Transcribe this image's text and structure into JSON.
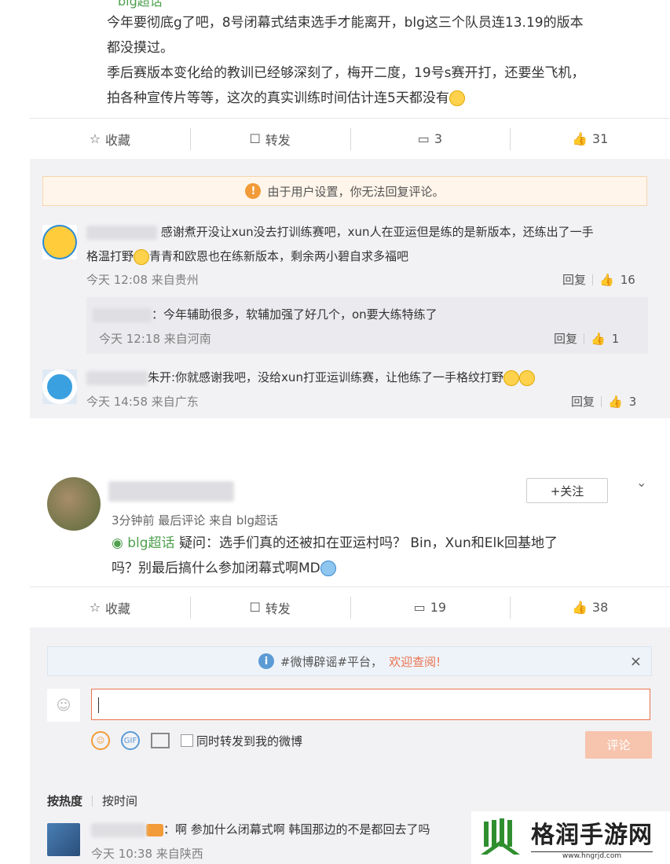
{
  "post1": {
    "topic_label": "blg超话",
    "lines": [
      "今年要彻底g了吧，8号闭幕式结束选手才能离开，blg这三个队员连13.19的版本",
      "都没摸过。",
      "季后赛版本变化给的教训已经够深刻了，梅开二度，19号s赛开打，还要坐飞机，",
      "拍各种宣传片等等，这次的真实训练时间估计连5天都没有"
    ],
    "actions": {
      "favorite": "收藏",
      "repost": "转发",
      "comments": "3",
      "likes": "31"
    },
    "notice": "由于用户设置，你无法回复评论。",
    "comments": [
      {
        "line1": "感谢煮开没让xun没去打训练赛吧，xun人在亚运但是练的是新版本，还练出了一手",
        "line2_a": "格温打野",
        "line2_b": "青青和欧恩也在练新版本，剩余两小碧自求多福吧",
        "time": "今天 12:08 来自贵州",
        "reply": "回复",
        "likes": "16"
      },
      {
        "text": "：今年辅助很多，软辅加强了好几个，on要大练特练了",
        "time": "今天 12:18 来自河南",
        "reply": "回复",
        "likes": "1"
      },
      {
        "text": "朱开:你就感谢我吧，没给xun打亚运训练赛，让他练了一手格纹打野",
        "time": "今天 14:58 来自广东",
        "reply": "回复",
        "likes": "3"
      }
    ]
  },
  "post2": {
    "follow": "+关注",
    "meta": "3分钟前 最后评论 来自 blg超话",
    "topic_label": "blg超话",
    "line1": " 疑问：选手们真的还被扣在亚运村吗？ Bin，Xun和Elk回基地了",
    "line2": "吗？别最后搞什么参加闭幕式啊MD",
    "actions": {
      "favorite": "收藏",
      "repost": "转发",
      "comments": "19",
      "likes": "38"
    },
    "tip_text": "#微博辟谣#平台，",
    "tip_link": "欢迎查阅!",
    "close": "×",
    "repost_check": "同时转发到我的微博",
    "submit": "评论",
    "sort_hot": "按热度",
    "sort_time": "按时间",
    "comment": {
      "text": "：啊 参加什么闭幕式啊 韩国那边的不是都回去了吗",
      "time": "今天 10:38 来自陕西"
    }
  },
  "watermark": {
    "title": "格润手游网",
    "url": "www.hngrjd.com"
  },
  "colors": {
    "accent": "#eb7350",
    "topic_green": "#4fa04f",
    "panel": "#f2f2f5"
  }
}
